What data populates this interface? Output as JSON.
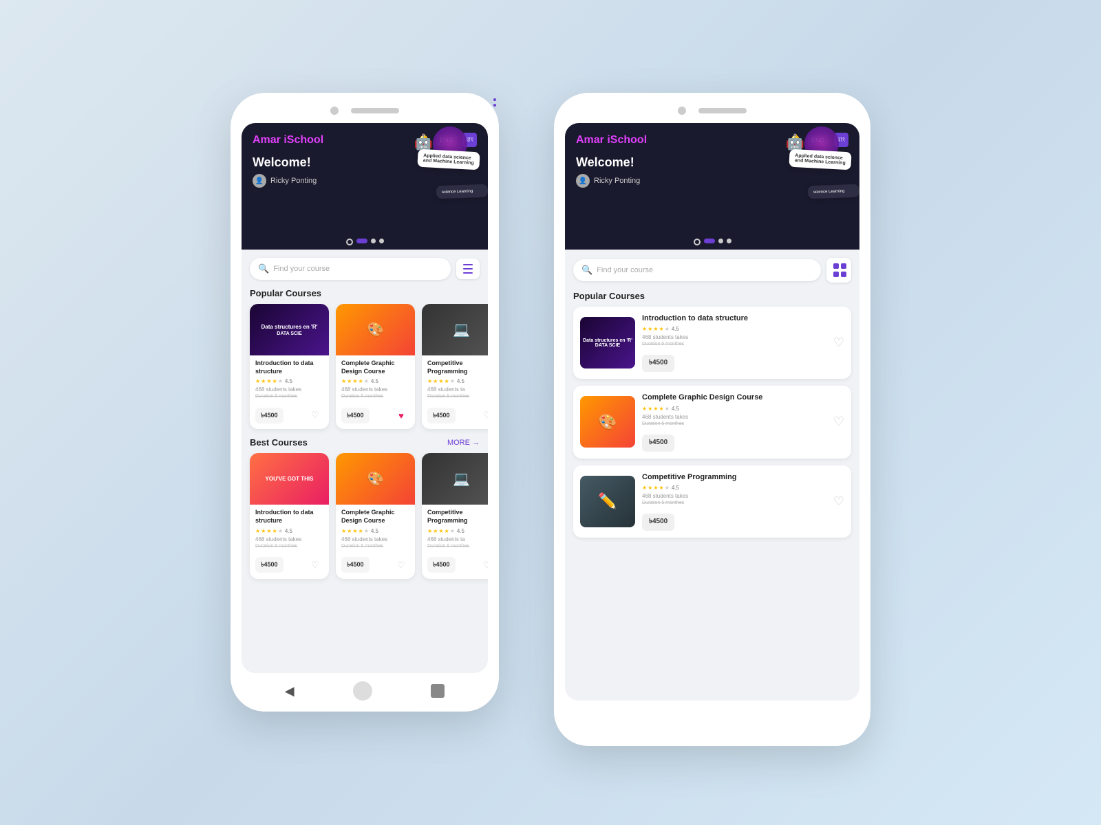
{
  "background": "#d0e8f5",
  "phone_small": {
    "logo": "Amar iSchool",
    "logo_accent": "i",
    "welcome": "Welcome!",
    "user": "Ricky Ponting",
    "lang1": "ENG",
    "lang2": "বাং",
    "search_placeholder": "Find your course",
    "popular_courses_title": "Popular Courses",
    "best_courses_title": "Best Courses",
    "more_label": "MORE →",
    "courses": [
      {
        "name": "Introduction to data structure",
        "rating": "4.5",
        "students": "468 students takes",
        "duration": "Duration 5 monthes",
        "price": "৳4500",
        "thumb_type": "ds",
        "heart": "empty"
      },
      {
        "name": "Complete Graphic Design Course",
        "rating": "4.5",
        "students": "468 students takes",
        "duration": "Duration 5 monthes",
        "price": "৳4500",
        "thumb_type": "graphic",
        "heart": "filled"
      },
      {
        "name": "Competitive Programming",
        "rating": "4.5",
        "students": "468 students ta",
        "duration": "Duration 5 monthes",
        "price": "৳4500",
        "thumb_type": "competitive",
        "heart": "empty"
      }
    ],
    "best_courses": [
      {
        "name": "Introduction to data structure",
        "rating": "4.5",
        "students": "468 students takes",
        "duration": "Duration 5 monthes",
        "price": "৳4500",
        "thumb_type": "youve",
        "heart": "empty"
      },
      {
        "name": "Complete Graphic Design Course",
        "rating": "4.5",
        "students": "468 students takes",
        "duration": "Duration 5 monthes",
        "price": "৳4500",
        "thumb_type": "graphic",
        "heart": "empty"
      },
      {
        "name": "Competitive Programming",
        "rating": "4.5",
        "students": "468 students ta",
        "duration": "Duration 5 monthes",
        "price": "৳4500",
        "thumb_type": "competitive",
        "heart": "empty"
      }
    ]
  },
  "phone_large": {
    "logo": "Amar iSchool",
    "logo_accent": "i",
    "welcome": "Welcome!",
    "user": "Ricky Ponting",
    "lang1": "ENG",
    "lang2": "বাং",
    "search_placeholder": "Find your course",
    "popular_courses_title": "Popular Courses",
    "list_courses": [
      {
        "name": "Introduction to data structure",
        "rating": "4.5",
        "students": "468 students takes",
        "duration": "Duration 5 monthes",
        "price": "৳4500",
        "thumb_type": "ds",
        "heart": "empty"
      },
      {
        "name": "Complete Graphic Design Course",
        "rating": "4.5",
        "students": "468 students takes",
        "duration": "Duration 5 monthes",
        "price": "৳4500",
        "thumb_type": "graphic",
        "heart": "empty"
      },
      {
        "name": "Competitive Programming",
        "rating": "4.5",
        "students": "468 students takes",
        "duration": "Duration 5 monthes",
        "price": "৳4500",
        "thumb_type": "competitive",
        "heart": "empty"
      }
    ]
  }
}
